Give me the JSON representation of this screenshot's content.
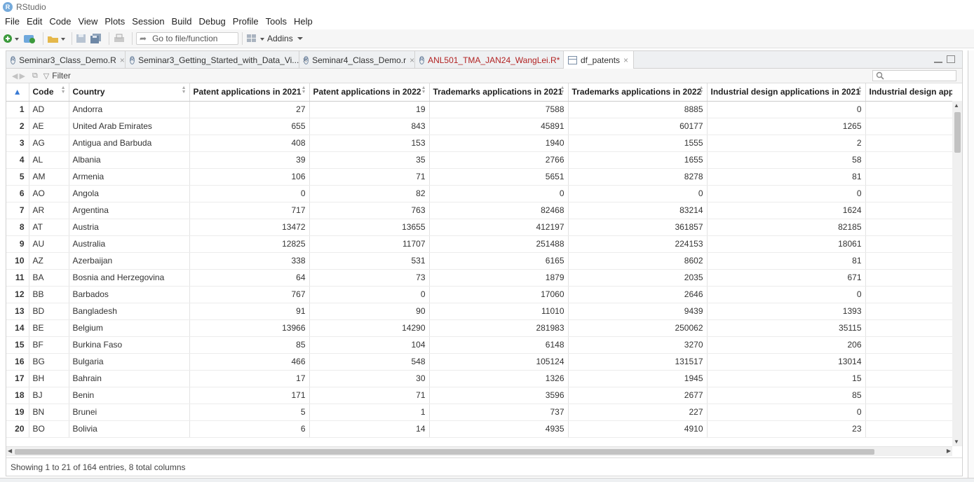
{
  "app": {
    "title": "RStudio",
    "logo": "R"
  },
  "menu": [
    "File",
    "Edit",
    "Code",
    "View",
    "Plots",
    "Session",
    "Build",
    "Debug",
    "Profile",
    "Tools",
    "Help"
  ],
  "toolbar": {
    "goto_placeholder": "Go to file/function",
    "addins_label": "Addins"
  },
  "tabs": [
    {
      "label": "Seminar3_Class_Demo.R",
      "icon": "r-script-icon",
      "modified": false,
      "active": false
    },
    {
      "label": "Seminar3_Getting_Started_with_Data_Vi...",
      "icon": "r-script-icon",
      "modified": false,
      "active": false
    },
    {
      "label": "Seminar4_Class_Demo.r",
      "icon": "r-script-icon",
      "modified": false,
      "active": false
    },
    {
      "label": "ANL501_TMA_JAN24_WangLei.R*",
      "icon": "r-script-icon",
      "modified": true,
      "active": false
    },
    {
      "label": "df_patents",
      "icon": "grid-icon",
      "modified": false,
      "active": true
    }
  ],
  "viewer": {
    "filter_label": "Filter",
    "columns": [
      "Code",
      "Country",
      "Patent applications in 2021",
      "Patent applications in 2022",
      "Trademarks applications in 2021",
      "Trademarks applications in 2022",
      "Industrial design applications in 2021",
      "Industrial design applicatio"
    ],
    "rows": [
      [
        "1",
        "AD",
        "Andorra",
        "27",
        "19",
        "7588",
        "8885",
        "0"
      ],
      [
        "2",
        "AE",
        "United Arab Emirates",
        "655",
        "843",
        "45891",
        "60177",
        "1265"
      ],
      [
        "3",
        "AG",
        "Antigua and Barbuda",
        "408",
        "153",
        "1940",
        "1555",
        "2"
      ],
      [
        "4",
        "AL",
        "Albania",
        "39",
        "35",
        "2766",
        "1655",
        "58"
      ],
      [
        "5",
        "AM",
        "Armenia",
        "106",
        "71",
        "5651",
        "8278",
        "81"
      ],
      [
        "6",
        "AO",
        "Angola",
        "0",
        "82",
        "0",
        "0",
        "0"
      ],
      [
        "7",
        "AR",
        "Argentina",
        "717",
        "763",
        "82468",
        "83214",
        "1624"
      ],
      [
        "8",
        "AT",
        "Austria",
        "13472",
        "13655",
        "412197",
        "361857",
        "82185"
      ],
      [
        "9",
        "AU",
        "Australia",
        "12825",
        "11707",
        "251488",
        "224153",
        "18061"
      ],
      [
        "10",
        "AZ",
        "Azerbaijan",
        "338",
        "531",
        "6165",
        "8602",
        "81"
      ],
      [
        "11",
        "BA",
        "Bosnia and Herzegovina",
        "64",
        "73",
        "1879",
        "2035",
        "671"
      ],
      [
        "12",
        "BB",
        "Barbados",
        "767",
        "0",
        "17060",
        "2646",
        "0"
      ],
      [
        "13",
        "BD",
        "Bangladesh",
        "91",
        "90",
        "11010",
        "9439",
        "1393"
      ],
      [
        "14",
        "BE",
        "Belgium",
        "13966",
        "14290",
        "281983",
        "250062",
        "35115"
      ],
      [
        "15",
        "BF",
        "Burkina Faso",
        "85",
        "104",
        "6148",
        "3270",
        "206"
      ],
      [
        "16",
        "BG",
        "Bulgaria",
        "466",
        "548",
        "105124",
        "131517",
        "13014"
      ],
      [
        "17",
        "BH",
        "Bahrain",
        "17",
        "30",
        "1326",
        "1945",
        "15"
      ],
      [
        "18",
        "BJ",
        "Benin",
        "171",
        "71",
        "3596",
        "2677",
        "85"
      ],
      [
        "19",
        "BN",
        "Brunei",
        "5",
        "1",
        "737",
        "227",
        "0"
      ],
      [
        "20",
        "BO",
        "Bolivia",
        "6",
        "14",
        "4935",
        "4910",
        "23"
      ]
    ],
    "status": "Showing 1 to 21 of 164 entries, 8 total columns"
  }
}
